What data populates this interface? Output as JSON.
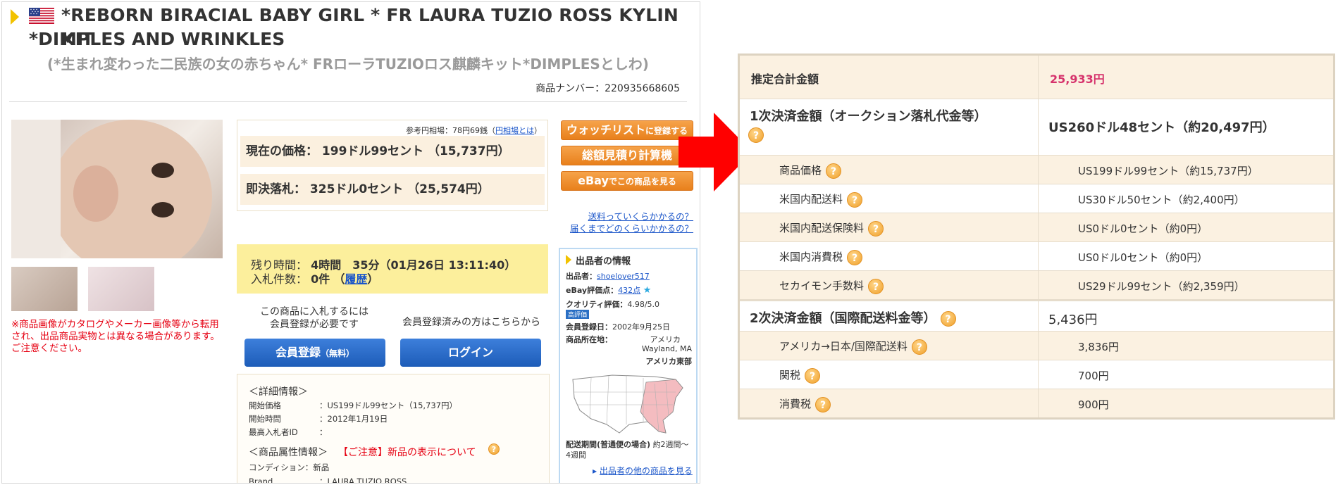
{
  "listing": {
    "title_en_line1": "*REBORN BIRACIAL BABY GIRL * FR LAURA TUZIO ROSS KYLIN KIT",
    "title_en_line2": "*DIMPLES AND WRINKLES",
    "title_jp": "(*生まれ変わった二民族の女の赤ちゃん* FRローラTUZIOロス麒麟キット*DIMPLESとしわ)",
    "item_number_label": "商品ナンバー：",
    "item_number": "220935668605",
    "photo_note": "※商品画像がカタログやメーカー画像等から転用され、出品商品実物とは異なる場合があります。ご注意ください。"
  },
  "price": {
    "ref_rate_label": "参考円相場：78円69銭（",
    "ref_rate_link": "円相場とは",
    "ref_rate_close": "）",
    "current_label": "現在の価格：",
    "current_value": "199ドル99セント （15,737円）",
    "buyout_label": "即決落札：",
    "buyout_value": "325ドル0セント （25,574円）"
  },
  "actions": {
    "watchlist_main": "ウォッチリスト",
    "watchlist_sub": "に登録する",
    "estimate": "総額見積り計算機",
    "ebay_main": "eBay",
    "ebay_sub": "でこの商品を見る",
    "shipping_q1": "送料っていくらかかるの？",
    "shipping_q2": "届くまでどのくらいかかるの？"
  },
  "auction": {
    "remaining_label": "残り時間：",
    "remaining_value": "4時間　35分（01月26日 13:11:40）",
    "bids_label": "入札件数：",
    "bids_value": "0件",
    "history_link": "履歴",
    "paren_open": "（",
    "paren_close": "）"
  },
  "member": {
    "note_line1": "この商品に入札するには",
    "note_line2": "会員登録が必要です",
    "note_registered": "会員登録済みの方はこちらから",
    "register_main": "会員登録",
    "register_sub": "（無料）",
    "login": "ログイン"
  },
  "details": {
    "section1": "＜詳細情報＞",
    "rows": [
      {
        "label": "開始価格",
        "value": "：US199ドル99セント（15,737円）"
      },
      {
        "label": "開始時間",
        "value": "：2012年1月19日"
      },
      {
        "label": "最高入札者ID",
        "value": "："
      }
    ],
    "section2": "＜商品属性情報＞",
    "notice": "【ご注意】新品の表示について",
    "condition_label": "コンディション：",
    "condition_value": "新品",
    "brand_label": "Brand",
    "brand_value": "：LAURA TUZIO ROSS"
  },
  "seller": {
    "header": "出品者の情報",
    "seller_label": "出品者：",
    "seller_id": "shoelover517",
    "rating_label": "eBay評価点：",
    "rating_value": "432点",
    "quality_label": "クオリティ評価：",
    "quality_value": "4.98/5.0",
    "quality_badge": "高評価",
    "member_since_label": "会員登録日：",
    "member_since_value": "2002年9月25日",
    "location_label": "商品所在地：",
    "location_country": "アメリカ",
    "location_city": "Wayland, MA",
    "location_region": "アメリカ東部",
    "delivery_label": "配送期間(普通便の場合)",
    "delivery_value": "約2週間〜4週間",
    "other_items_link": "出品者の他の商品を見る"
  },
  "cost_table": {
    "total_label": "推定合計金額",
    "total_value": "25,933円",
    "first_label": "1次決済金額（オークション落札代金等）",
    "first_value": "US260ドル48セント（約20,497円）",
    "first_rows": [
      {
        "label": "商品価格",
        "value": "US199ドル99セント（約15,737円）"
      },
      {
        "label": "米国内配送料",
        "value": "US30ドル50セント（約2,400円）"
      },
      {
        "label": "米国内配送保険料",
        "value": "US0ドル0セント（約0円）"
      },
      {
        "label": "米国内消費税",
        "value": "US0ドル0セント（約0円）"
      },
      {
        "label": "セカイモン手数料",
        "value": "US29ドル99セント（約2,359円）"
      }
    ],
    "second_label": "2次決済金額（国際配送料金等）",
    "second_value": "5,436円",
    "second_rows": [
      {
        "label": "アメリカ→日本/国際配送料",
        "value": "3,836円"
      },
      {
        "label": "関税",
        "value": "700円"
      },
      {
        "label": "消費税",
        "value": "900円"
      }
    ],
    "help_glyph": "?"
  },
  "colors": {
    "accent_red": "#e60012",
    "total_pink": "#d6336c",
    "orange_button": "#e8801c",
    "blue_button": "#1d5cb8",
    "time_box_yellow": "#fcef9c",
    "table_header_bg": "#fbf1e1"
  }
}
